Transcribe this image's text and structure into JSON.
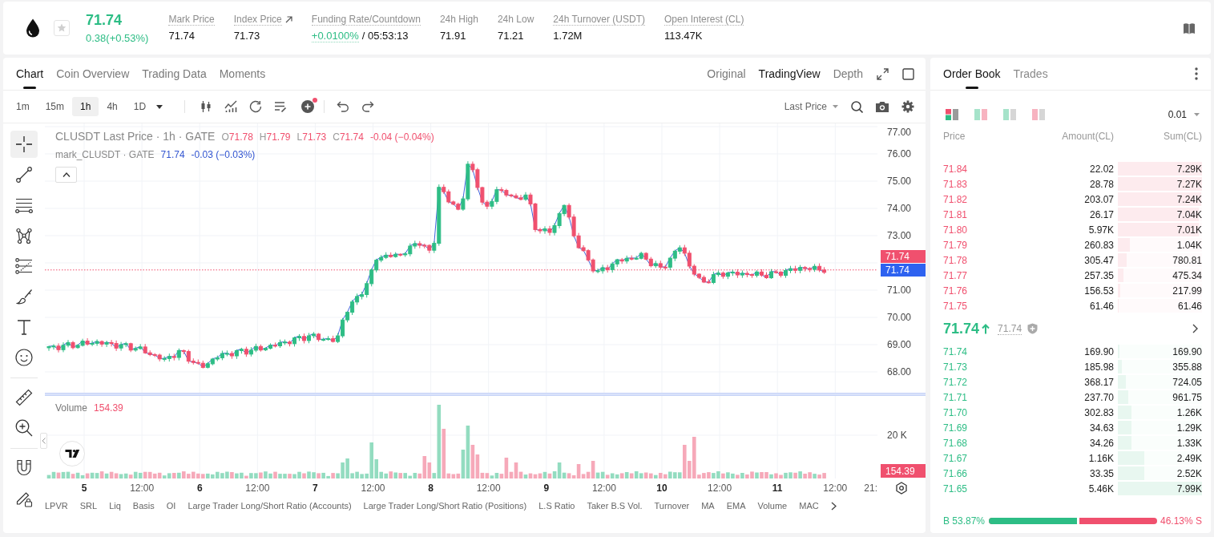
{
  "ticker": {
    "price": "71.74",
    "change": "0.38(+0.53%)",
    "rising": true,
    "favorite": false
  },
  "stats": [
    {
      "kind": "plain",
      "label": "Mark Price",
      "tooltip": true,
      "value": "71.74"
    },
    {
      "kind": "link",
      "label": "Index Price",
      "tooltip": true,
      "value": "71.73"
    },
    {
      "kind": "funding",
      "label": "Funding Rate/Countdown",
      "tooltip": true,
      "rate": "+0.0100%",
      "positive": true,
      "countdown": "/ 05:53:13"
    },
    {
      "kind": "plain",
      "label": "24h High",
      "tooltip": false,
      "value": "71.91"
    },
    {
      "kind": "plain",
      "label": "24h Low",
      "tooltip": false,
      "value": "71.21"
    },
    {
      "kind": "plain",
      "label": "24h Turnover (USDT)",
      "tooltip": true,
      "value": "1.72M"
    },
    {
      "kind": "plain",
      "label": "Open Interest (CL)",
      "tooltip": true,
      "value": "113.47K"
    }
  ],
  "chart_panel": {
    "tabs": [
      {
        "label": "Chart",
        "selected": true
      },
      {
        "label": "Coin Overview",
        "selected": false
      },
      {
        "label": "Trading Data",
        "selected": false
      },
      {
        "label": "Moments",
        "selected": false
      }
    ],
    "views": [
      {
        "label": "Original",
        "selected": false
      },
      {
        "label": "TradingView",
        "selected": true
      },
      {
        "label": "Depth",
        "selected": false
      }
    ],
    "intervals": [
      {
        "label": "1m",
        "selected": false
      },
      {
        "label": "15m",
        "selected": false
      },
      {
        "label": "1h",
        "selected": true
      },
      {
        "label": "4h",
        "selected": false
      },
      {
        "label": "1D",
        "selected": false
      }
    ],
    "toolbar": {
      "alert": true,
      "price_source": "Last Price"
    },
    "drawing_tools": [
      [
        {
          "kind": "crosshair",
          "selected": true
        },
        {
          "kind": "trend_line",
          "selected": false
        },
        {
          "kind": "horizontal_lines",
          "selected": false
        },
        {
          "kind": "pattern",
          "selected": false
        },
        {
          "kind": "fib",
          "selected": false
        },
        {
          "kind": "brush",
          "selected": false
        },
        {
          "kind": "text",
          "selected": false
        },
        {
          "kind": "emoji",
          "selected": false
        }
      ],
      [
        {
          "kind": "measure",
          "selected": false
        },
        {
          "kind": "zoom",
          "selected": false
        }
      ],
      [
        {
          "kind": "magnet",
          "selected": false
        },
        {
          "kind": "lock",
          "selected": false
        }
      ]
    ],
    "legend": {
      "title": "CLUSDT Last Price · 1h · GATE",
      "ohlc": [
        {
          "key": "O",
          "value": "71.78"
        },
        {
          "key": "H",
          "value": "71.79"
        },
        {
          "key": "L",
          "value": "71.73"
        },
        {
          "key": "C",
          "value": "71.74"
        }
      ],
      "change": "-0.04 (−0.04%)",
      "rising": false
    },
    "mark_legend": {
      "title": "mark_CLUSDT · GATE",
      "value": "71.74",
      "change": "-0.03 (−0.03%)"
    },
    "price_axis": {
      "upper_labels": [
        "77.00",
        "76.00",
        "75.00",
        "74.00",
        "73.00"
      ],
      "last_price_tag": "71.74",
      "mark_price_tag": "71.74",
      "lower_labels": [
        "71.00",
        "70.00",
        "69.00",
        "68.00"
      ]
    },
    "volume": {
      "title": "Volume",
      "value": "154.39",
      "rising": false,
      "axis_label": "20 K",
      "tag": "154.39"
    },
    "time_axis": [
      {
        "label": "5",
        "kind": "day"
      },
      {
        "label": "12:00",
        "kind": "time"
      },
      {
        "label": "6",
        "kind": "day"
      },
      {
        "label": "12:00",
        "kind": "time"
      },
      {
        "label": "7",
        "kind": "day"
      },
      {
        "label": "12:00",
        "kind": "time"
      },
      {
        "label": "8",
        "kind": "day"
      },
      {
        "label": "12:00",
        "kind": "time"
      },
      {
        "label": "9",
        "kind": "day"
      },
      {
        "label": "12:00",
        "kind": "time"
      },
      {
        "label": "10",
        "kind": "day"
      },
      {
        "label": "12:00",
        "kind": "time"
      },
      {
        "label": "11",
        "kind": "day"
      },
      {
        "label": "12:00",
        "kind": "time"
      },
      {
        "label": "21:",
        "kind": "time"
      }
    ],
    "indicators": [
      "LPVR",
      "SRL",
      "Liq",
      "Basis",
      "OI",
      "Large Trader Long/Short Ratio (Accounts)",
      "Large Trader Long/Short Ratio (Positions)",
      "L.S Ratio",
      "Taker B.S Vol.",
      "Turnover",
      "MA",
      "EMA",
      "Volume",
      "MAC"
    ]
  },
  "order_book": {
    "tabs": [
      {
        "label": "Order Book",
        "selected": true
      },
      {
        "label": "Trades",
        "selected": false
      }
    ],
    "layouts": [
      {
        "kind": "both",
        "selected": true
      },
      {
        "kind": "split",
        "selected": false
      },
      {
        "kind": "bids",
        "selected": false
      },
      {
        "kind": "asks",
        "selected": false
      }
    ],
    "precision": "0.01",
    "columns": [
      "Price",
      "Amount(CL)",
      "Sum(CL)"
    ],
    "asks": [
      {
        "price": "71.84",
        "amount": "22.02",
        "sum": "7.29K",
        "level": 1
      },
      {
        "price": "71.83",
        "amount": "28.78",
        "sum": "7.27K",
        "level": 0.997
      },
      {
        "price": "71.82",
        "amount": "203.07",
        "sum": "7.24K",
        "level": 0.993
      },
      {
        "price": "71.81",
        "amount": "26.17",
        "sum": "7.04K",
        "level": 0.966
      },
      {
        "price": "71.80",
        "amount": "5.97K",
        "sum": "7.01K",
        "level": 0.962
      },
      {
        "price": "71.79",
        "amount": "260.83",
        "sum": "1.04K",
        "level": 0.143
      },
      {
        "price": "71.78",
        "amount": "305.47",
        "sum": "780.81",
        "level": 0.107
      },
      {
        "price": "71.77",
        "amount": "257.35",
        "sum": "475.34",
        "level": 0.065
      },
      {
        "price": "71.76",
        "amount": "156.53",
        "sum": "217.99",
        "level": 0.03
      },
      {
        "price": "71.75",
        "amount": "61.46",
        "sum": "61.46",
        "level": 0.008
      }
    ],
    "last_price": {
      "price": "71.74",
      "rising": true,
      "mark": "71.74"
    },
    "bids": [
      {
        "price": "71.74",
        "amount": "169.90",
        "sum": "169.90",
        "level": 0.021
      },
      {
        "price": "71.73",
        "amount": "185.98",
        "sum": "355.88",
        "level": 0.045
      },
      {
        "price": "71.72",
        "amount": "368.17",
        "sum": "724.05",
        "level": 0.091
      },
      {
        "price": "71.71",
        "amount": "237.70",
        "sum": "961.75",
        "level": 0.12
      },
      {
        "price": "71.70",
        "amount": "302.83",
        "sum": "1.26K",
        "level": 0.158
      },
      {
        "price": "71.69",
        "amount": "34.63",
        "sum": "1.29K",
        "level": 0.161
      },
      {
        "price": "71.68",
        "amount": "34.26",
        "sum": "1.33K",
        "level": 0.166
      },
      {
        "price": "71.67",
        "amount": "1.16K",
        "sum": "2.49K",
        "level": 0.312
      },
      {
        "price": "71.66",
        "amount": "33.35",
        "sum": "2.52K",
        "level": 0.315
      },
      {
        "price": "71.65",
        "amount": "5.46K",
        "sum": "7.99K",
        "level": 1
      }
    ],
    "ratio": {
      "buy": "B 53.87%",
      "sell": "46.13% S",
      "level": 0.5387
    }
  }
}
